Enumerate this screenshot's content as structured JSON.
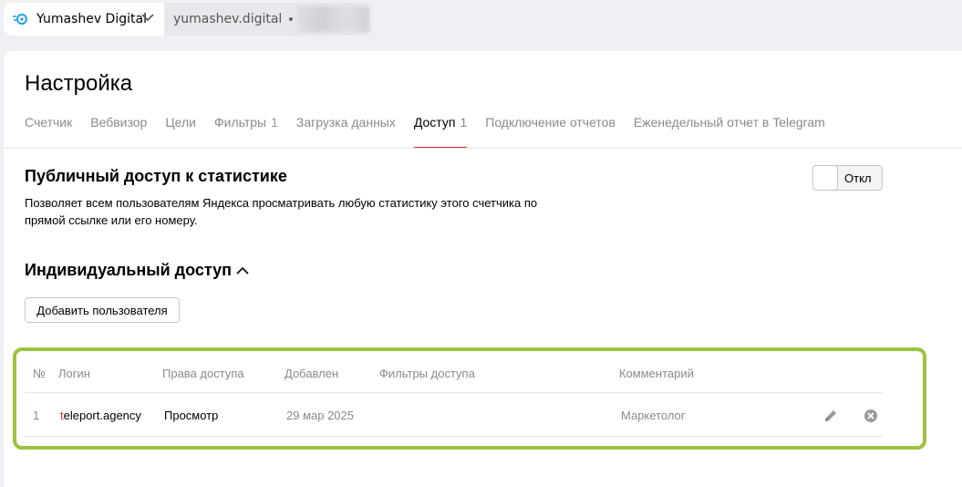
{
  "header": {
    "counter_name": "Yumashev Digital",
    "domain": "yumashev.digital"
  },
  "page": {
    "title": "Настройка",
    "tabs": [
      {
        "label": "Счетчик",
        "count": ""
      },
      {
        "label": "Вебвизор",
        "count": ""
      },
      {
        "label": "Цели",
        "count": ""
      },
      {
        "label": "Фильтры",
        "count": "1"
      },
      {
        "label": "Загрузка данных",
        "count": ""
      },
      {
        "label": "Доступ",
        "count": "1",
        "active": true
      },
      {
        "label": "Подключение отчетов",
        "count": ""
      },
      {
        "label": "Еженедельный отчет в Telegram",
        "count": ""
      }
    ]
  },
  "public_access": {
    "title": "Публичный доступ к статистике",
    "description": "Позволяет всем пользователям Яндекса просматривать любую статистику этого счетчика по прямой ссылке или его номеру.",
    "toggle_label": "Откл",
    "enabled": false
  },
  "individual_access": {
    "title": "Индивидуальный доступ",
    "add_user_label": "Добавить пользователя",
    "columns": [
      "№",
      "Логин",
      "Права доступа",
      "Добавлен",
      "Фильтры доступа",
      "Комментарий"
    ],
    "rows": [
      {
        "num": "1",
        "login_first": "t",
        "login_rest": "eleport.agency",
        "rights": "Просмотр",
        "added": "29 мар 2025",
        "filters": "",
        "comment": "Маркетолог"
      }
    ]
  },
  "colors": {
    "accent_red": "#e0312a",
    "highlight_green": "#9cc33f",
    "logo_blue": "#1fa3e0"
  },
  "icons": [
    "counter-logo-icon",
    "chevron-down-icon",
    "chevron-up-icon",
    "pencil-icon",
    "close-circle-icon"
  ]
}
